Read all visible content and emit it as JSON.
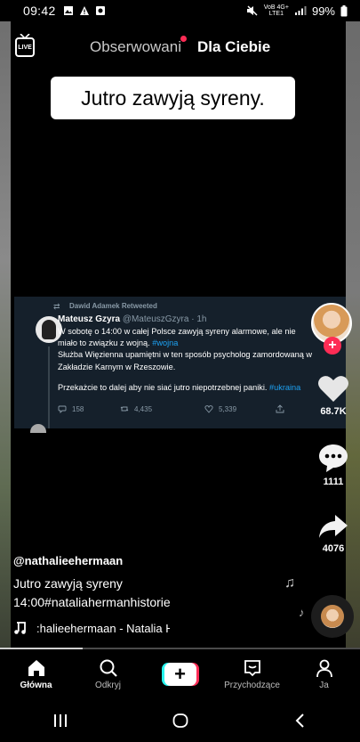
{
  "status_bar": {
    "time": "09:42",
    "network_top": "VoB 4G+",
    "network_bottom": "LTE1",
    "battery": "99%"
  },
  "top_nav": {
    "live_label": "LIVE",
    "tab_following": "Obserwowani",
    "tab_for_you": "Dla Ciebie"
  },
  "video": {
    "caption_overlay": "Jutro zawyją syreny.",
    "tweet": {
      "retweeted_by": "Dawid Adamek Retweeted",
      "author_name": "Mateusz Gzyra",
      "author_handle": "@MateuszGzyra · 1h",
      "line1": "W sobotę o 14:00 w całej Polsce zawyją syreny alarmowe, ale nie",
      "line2a": "miało to związku z wojną. ",
      "line2_tag": "#wojna",
      "line3": "Służba Więzienna upamiętni w ten sposób psycholog zamordowaną w",
      "line4": "Zakładzie Karnym w Rzeszowie.",
      "line5a": "Przekażcie to dalej aby nie siać jutro niepotrzebnej paniki. ",
      "line5_tag": "#ukraina",
      "replies": "158",
      "retweets": "4,435",
      "likes": "5,339"
    }
  },
  "side_actions": {
    "likes_count": "68.7K",
    "comments_count": "1111",
    "shares_count": "4076"
  },
  "post_info": {
    "author": "@nathalieehermaan",
    "description_line1": "Jutro zawyją syreny",
    "description_line2": "14:00#nataliahermanhistorie",
    "music": ":halieehermaan - Natalia H"
  },
  "progress": 0.23,
  "bottom_nav": {
    "home": "Główna",
    "discover": "Odkryj",
    "inbox": "Przychodzące",
    "profile": "Ja"
  },
  "colors": {
    "accent": "#fe2c55",
    "cyan": "#25f4ee",
    "tweet_bg": "#15202b",
    "link_blue": "#1da1f2"
  }
}
